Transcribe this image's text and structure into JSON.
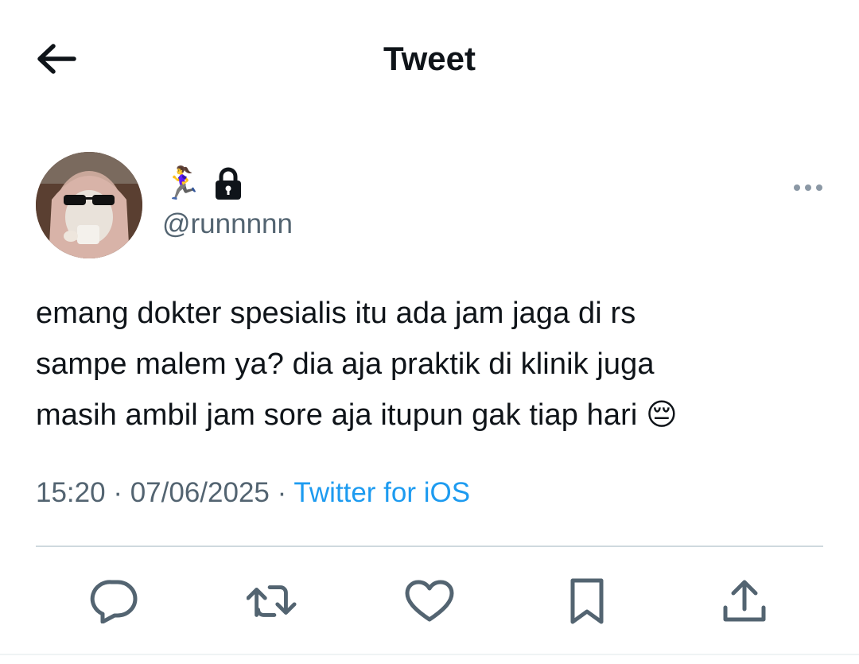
{
  "header": {
    "title": "Tweet",
    "back_icon": "arrow-left-icon"
  },
  "author": {
    "display_name_emoji": "🏃‍♀️",
    "protected_icon": "lock-icon",
    "handle": "@runnnnn",
    "avatar_description": "avatar"
  },
  "tweet": {
    "lines": [
      "emang dokter spesialis itu ada jam jaga di rs",
      "sampe malem ya? dia aja praktik di klinik juga",
      "masih ambil jam sore aja itupun gak tiap hari 😔"
    ],
    "time": "15:20",
    "separator": "·",
    "date": "07/06/2025",
    "source": "Twitter for iOS"
  },
  "actions": {
    "reply_icon": "reply-icon",
    "retweet_icon": "retweet-icon",
    "like_icon": "heart-icon",
    "bookmark_icon": "bookmark-icon",
    "share_icon": "share-icon"
  },
  "colors": {
    "text": "#0f1419",
    "secondary": "#536471",
    "accent": "#1d9bf0",
    "divider": "#cfd9de"
  }
}
